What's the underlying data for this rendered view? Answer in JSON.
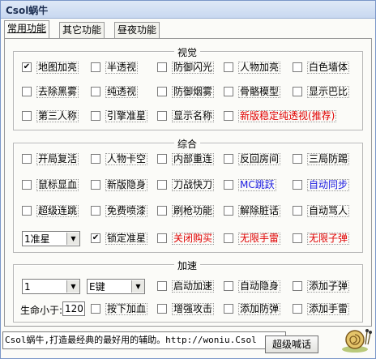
{
  "window": {
    "title": "Csol蜗牛"
  },
  "tabs": [
    "常用功能",
    "其它功能",
    "昼夜功能"
  ],
  "visual": {
    "title": "视觉",
    "items": [
      {
        "label": "地图加亮",
        "checked": true
      },
      {
        "label": "半透视",
        "checked": false
      },
      {
        "label": "防御闪光",
        "checked": false
      },
      {
        "label": "人物加亮",
        "checked": false
      },
      {
        "label": "白色墙体",
        "checked": false
      },
      {
        "label": "去除黑雾",
        "checked": false
      },
      {
        "label": "纯透视",
        "checked": false
      },
      {
        "label": "防御烟雾",
        "checked": false
      },
      {
        "label": "骨骼模型",
        "checked": false
      },
      {
        "label": "显示巴比",
        "checked": false
      },
      {
        "label": "第三人称",
        "checked": false
      },
      {
        "label": "引擎准星",
        "checked": false
      },
      {
        "label": "显示名称",
        "checked": false
      },
      {
        "label": "新版稳定纯透视(推荐)",
        "checked": false,
        "color": "red"
      }
    ]
  },
  "general": {
    "title": "综合",
    "items": [
      {
        "label": "开局复活",
        "checked": false
      },
      {
        "label": "人物卡空",
        "checked": false
      },
      {
        "label": "内部重连",
        "checked": false
      },
      {
        "label": "反回房间",
        "checked": false
      },
      {
        "label": "三局防踢",
        "checked": false
      },
      {
        "label": "鼠标显血",
        "checked": false
      },
      {
        "label": "新版隐身",
        "checked": false
      },
      {
        "label": "刀战快刀",
        "checked": false
      },
      {
        "label": "MC跳跃",
        "checked": false,
        "color": "blue"
      },
      {
        "label": "自动同步",
        "checked": false,
        "color": "blue"
      },
      {
        "label": "超级连跳",
        "checked": false
      },
      {
        "label": "免费喷漆",
        "checked": false
      },
      {
        "label": "刷枪功能",
        "checked": false
      },
      {
        "label": "解除脏话",
        "checked": false
      },
      {
        "label": "自动骂人",
        "checked": false
      }
    ],
    "aim_select": "1准星",
    "row4": [
      {
        "label": "锁定准星",
        "checked": true
      },
      {
        "label": "关闭购买",
        "checked": false,
        "color": "red"
      },
      {
        "label": "无限手雷",
        "checked": false,
        "color": "red"
      },
      {
        "label": "无限子弹",
        "checked": false,
        "color": "red"
      }
    ]
  },
  "speed": {
    "title": "加速",
    "speed_select": "1",
    "key_select": "E键",
    "row1": [
      {
        "label": "启动加速",
        "checked": false
      },
      {
        "label": "自动隐身",
        "checked": false
      },
      {
        "label": "添加子弹",
        "checked": false
      }
    ],
    "hp_label": "生命小于:",
    "hp_value": "120",
    "row2": [
      {
        "label": "按下加血",
        "checked": false
      },
      {
        "label": "增强攻击",
        "checked": false
      },
      {
        "label": "添加防弹",
        "checked": false
      },
      {
        "label": "添加手雷",
        "checked": false
      }
    ]
  },
  "status": {
    "text": "Csol蜗牛,打造最经典的最好用的辅助。http://woniu.Csol",
    "button": "超级喊话"
  }
}
